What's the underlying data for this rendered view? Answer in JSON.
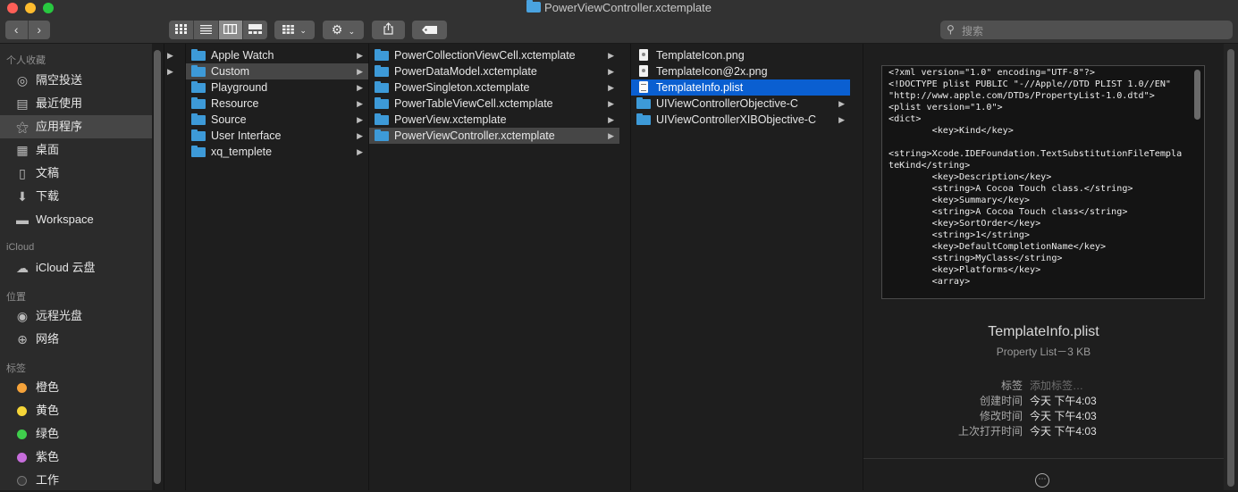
{
  "window": {
    "title": "PowerViewController.xctemplate"
  },
  "toolbar": {
    "back": "‹",
    "forward": "›",
    "view_modes": [
      "icon-view",
      "list-view",
      "column-view",
      "gallery-view"
    ],
    "active_view": "column-view",
    "search_placeholder": "搜索"
  },
  "sidebar": {
    "sections": [
      {
        "header": "个人收藏",
        "items": [
          {
            "label": "隔空投送",
            "icon": "airdrop-icon"
          },
          {
            "label": "最近使用",
            "icon": "recents-icon"
          },
          {
            "label": "应用程序",
            "icon": "applications-icon",
            "active": true
          },
          {
            "label": "桌面",
            "icon": "desktop-icon"
          },
          {
            "label": "文稿",
            "icon": "documents-icon"
          },
          {
            "label": "下载",
            "icon": "downloads-icon"
          },
          {
            "label": "Workspace",
            "icon": "folder-icon"
          }
        ]
      },
      {
        "header": "iCloud",
        "items": [
          {
            "label": "iCloud 云盘",
            "icon": "cloud-icon"
          }
        ]
      },
      {
        "header": "位置",
        "items": [
          {
            "label": "远程光盘",
            "icon": "disc-icon"
          },
          {
            "label": "网络",
            "icon": "network-icon"
          }
        ]
      },
      {
        "header": "标签",
        "items": [
          {
            "label": "橙色",
            "color": "#f6a33a"
          },
          {
            "label": "黄色",
            "color": "#f5d538"
          },
          {
            "label": "绿色",
            "color": "#3fce4c"
          },
          {
            "label": "紫色",
            "color": "#c66ddb"
          },
          {
            "label": "工作",
            "color": "#3a3a3a"
          }
        ]
      }
    ]
  },
  "columns": {
    "col1": [
      {
        "name": "Apple Watch"
      },
      {
        "name": "Custom",
        "selected": true
      },
      {
        "name": "Playground"
      },
      {
        "name": "Resource"
      },
      {
        "name": "Source"
      },
      {
        "name": "User Interface"
      },
      {
        "name": "xq_templete"
      }
    ],
    "col2": [
      {
        "name": "PowerCollectionViewCell.xctemplate"
      },
      {
        "name": "PowerDataModel.xctemplate"
      },
      {
        "name": "PowerSingleton.xctemplate"
      },
      {
        "name": "PowerTableViewCell.xctemplate"
      },
      {
        "name": "PowerView.xctemplate"
      },
      {
        "name": "PowerViewController.xctemplate",
        "selected": true
      }
    ],
    "col3": [
      {
        "name": "TemplateIcon.png",
        "type": "image"
      },
      {
        "name": "TemplateIcon@2x.png",
        "type": "image"
      },
      {
        "name": "TemplateInfo.plist",
        "type": "plist",
        "selected": true
      },
      {
        "name": "UIViewControllerObjective-C",
        "type": "folder"
      },
      {
        "name": "UIViewControllerXIBObjective-C",
        "type": "folder"
      }
    ]
  },
  "preview": {
    "code": "<?xml version=\"1.0\" encoding=\"UTF-8\"?>\n<!DOCTYPE plist PUBLIC \"-//Apple//DTD PLIST 1.0//EN\" \"http://www.apple.com/DTDs/PropertyList-1.0.dtd\">\n<plist version=\"1.0\">\n<dict>\n        <key>Kind</key>\n\n<string>Xcode.IDEFoundation.TextSubstitutionFileTemplateKind</string>\n        <key>Description</key>\n        <string>A Cocoa Touch class.</string>\n        <key>Summary</key>\n        <string>A Cocoa Touch class</string>\n        <key>SortOrder</key>\n        <string>1</string>\n        <key>DefaultCompletionName</key>\n        <string>MyClass</string>\n        <key>Platforms</key>\n        <array>",
    "file_name": "TemplateInfo.plist",
    "kind": "Property List－3 KB",
    "meta": [
      {
        "key": "标签",
        "value": "添加标签…",
        "placeholder": true
      },
      {
        "key": "创建时间",
        "value": "今天 下午4:03"
      },
      {
        "key": "修改时间",
        "value": "今天 下午4:03"
      },
      {
        "key": "上次打开时间",
        "value": "今天 下午4:03"
      }
    ],
    "more": "⋯"
  }
}
